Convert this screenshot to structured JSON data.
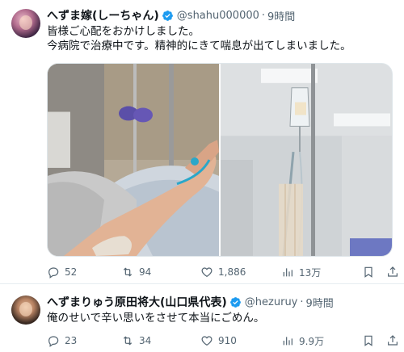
{
  "tweets": [
    {
      "author": {
        "display_name": "へずま嫁(しーちゃん)",
        "handle": "@shahu000000",
        "time": "9時間"
      },
      "text_lines": [
        "皆様ご心配をおかけしました。",
        "今病院で治療中です。精神的にきて喘息が出てしまいました。"
      ],
      "stats": {
        "replies": "52",
        "reposts": "94",
        "likes": "1,886",
        "views": "13万"
      }
    },
    {
      "author": {
        "display_name": "へずまりゅう原田将大(山口県代表)",
        "handle": "@hezuruy",
        "time": "9時間"
      },
      "text_lines": [
        "俺のせいで辛い思いをさせて本当にごめん。"
      ],
      "stats": {
        "replies": "23",
        "reposts": "34",
        "likes": "910",
        "views": "9.9万"
      }
    }
  ],
  "separator": "·",
  "colors": {
    "verified": "#1d9bf0",
    "muted": "#536471",
    "text": "#0f1419"
  }
}
